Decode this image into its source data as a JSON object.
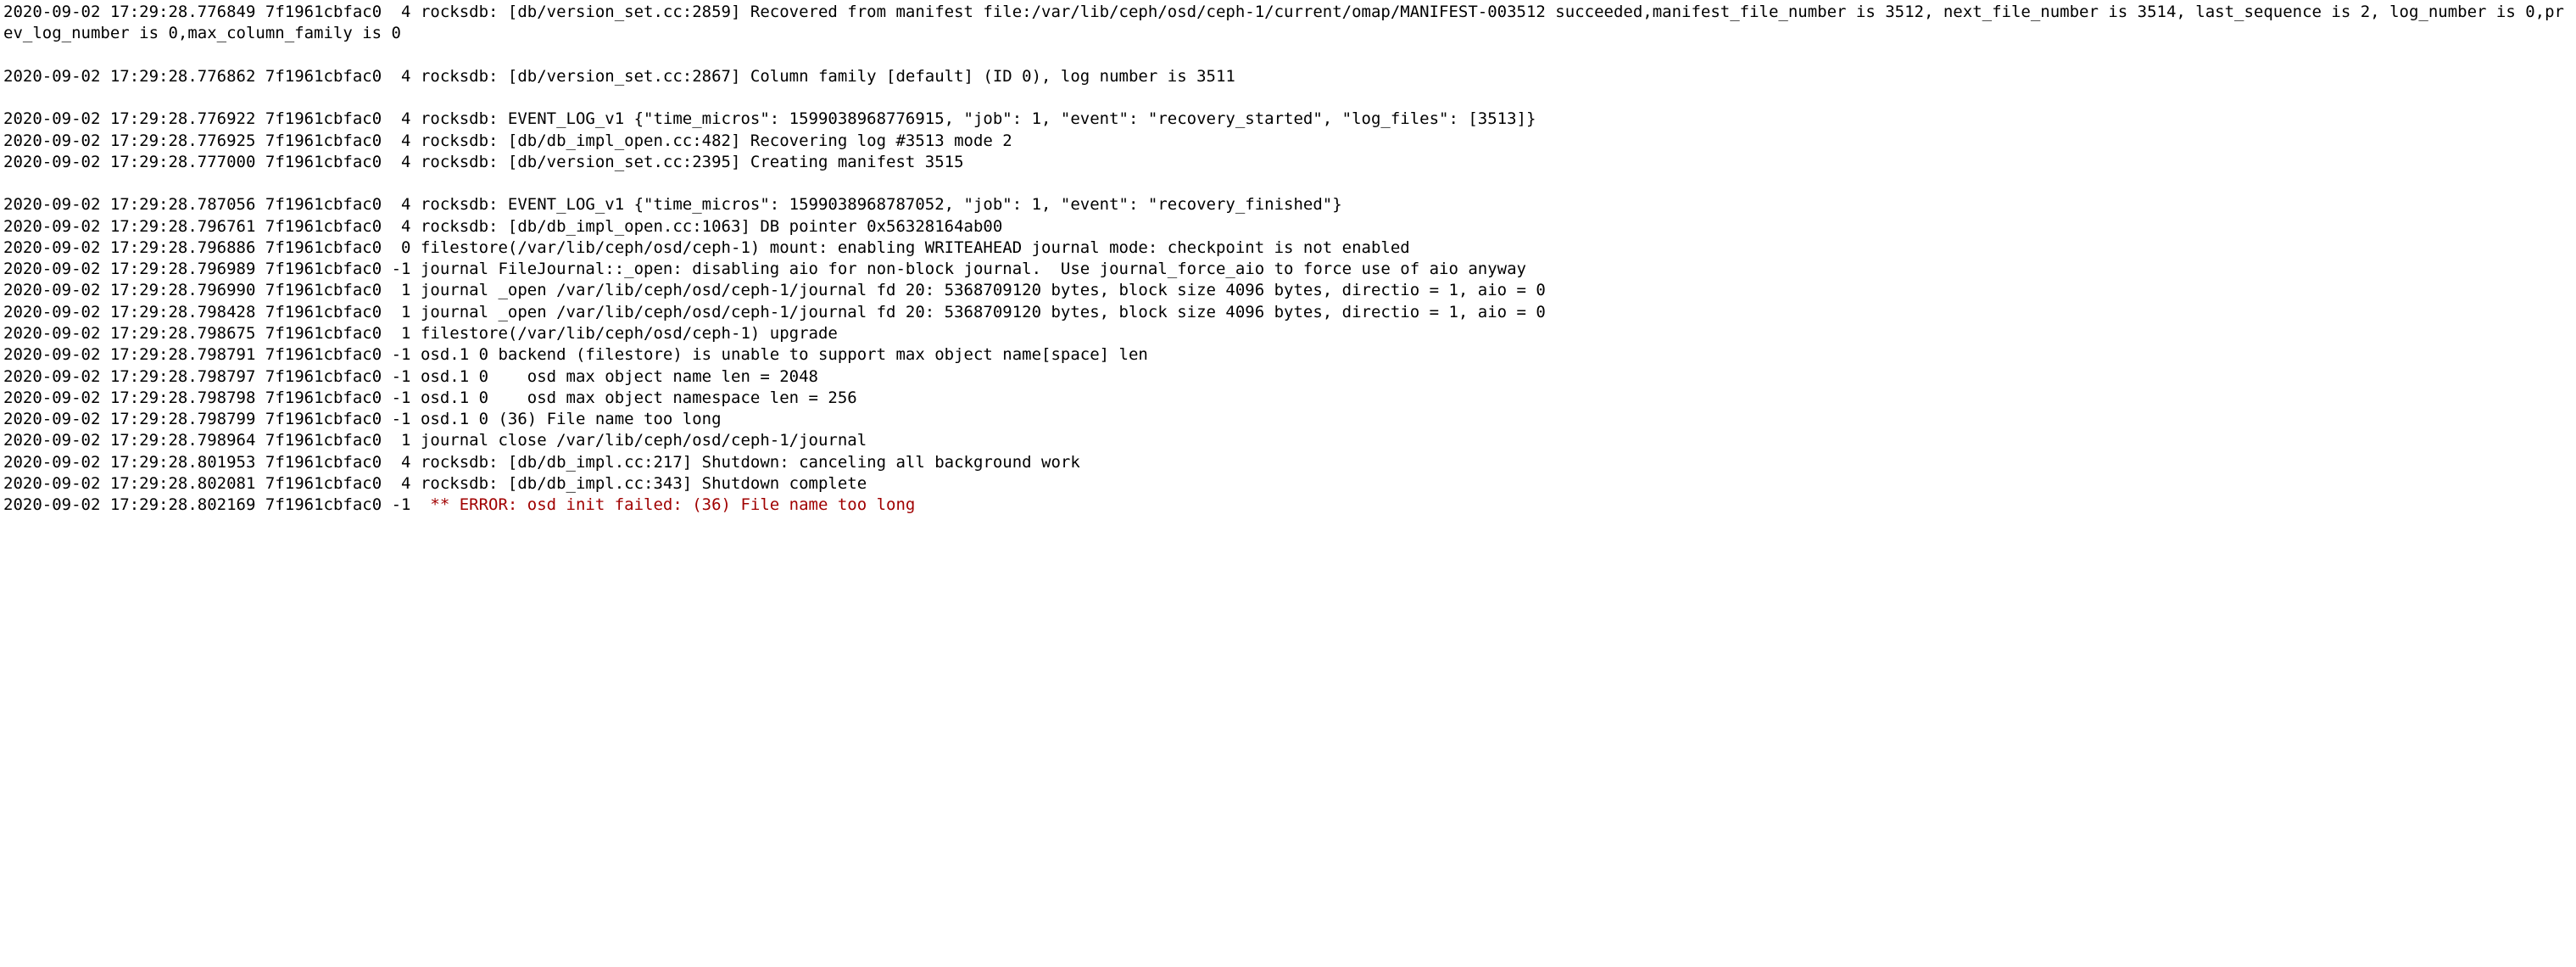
{
  "log_lines": [
    {
      "ts": "2020-09-02 17:29:28.776849",
      "thread": "7f1961cbfac0",
      "level": "4",
      "msg": "rocksdb: [db/version_set.cc:2859] Recovered from manifest file:/var/lib/ceph/osd/ceph-1/current/omap/MANIFEST-003512 succeeded,manifest_file_number is 3512, next_file_number is 3514, last_sequence is 2, log_number is 0,prev_log_number is 0,max_column_family is 0",
      "highlight": false,
      "blank_after": true
    },
    {
      "ts": "2020-09-02 17:29:28.776862",
      "thread": "7f1961cbfac0",
      "level": "4",
      "msg": "rocksdb: [db/version_set.cc:2867] Column family [default] (ID 0), log number is 3511",
      "highlight": false,
      "blank_after": true
    },
    {
      "ts": "2020-09-02 17:29:28.776922",
      "thread": "7f1961cbfac0",
      "level": "4",
      "msg": "rocksdb: EVENT_LOG_v1 {\"time_micros\": 1599038968776915, \"job\": 1, \"event\": \"recovery_started\", \"log_files\": [3513]}",
      "highlight": false,
      "blank_after": false
    },
    {
      "ts": "2020-09-02 17:29:28.776925",
      "thread": "7f1961cbfac0",
      "level": "4",
      "msg": "rocksdb: [db/db_impl_open.cc:482] Recovering log #3513 mode 2",
      "highlight": false,
      "blank_after": false
    },
    {
      "ts": "2020-09-02 17:29:28.777000",
      "thread": "7f1961cbfac0",
      "level": "4",
      "msg": "rocksdb: [db/version_set.cc:2395] Creating manifest 3515",
      "highlight": false,
      "blank_after": true
    },
    {
      "ts": "2020-09-02 17:29:28.787056",
      "thread": "7f1961cbfac0",
      "level": "4",
      "msg": "rocksdb: EVENT_LOG_v1 {\"time_micros\": 1599038968787052, \"job\": 1, \"event\": \"recovery_finished\"}",
      "highlight": false,
      "blank_after": false
    },
    {
      "ts": "2020-09-02 17:29:28.796761",
      "thread": "7f1961cbfac0",
      "level": "4",
      "msg": "rocksdb: [db/db_impl_open.cc:1063] DB pointer 0x56328164ab00",
      "highlight": false,
      "blank_after": false
    },
    {
      "ts": "2020-09-02 17:29:28.796886",
      "thread": "7f1961cbfac0",
      "level": "0",
      "msg": "filestore(/var/lib/ceph/osd/ceph-1) mount: enabling WRITEAHEAD journal mode: checkpoint is not enabled",
      "highlight": false,
      "blank_after": false
    },
    {
      "ts": "2020-09-02 17:29:28.796989",
      "thread": "7f1961cbfac0",
      "level": "-1",
      "msg": "journal FileJournal::_open: disabling aio for non-block journal.  Use journal_force_aio to force use of aio anyway",
      "highlight": false,
      "blank_after": false
    },
    {
      "ts": "2020-09-02 17:29:28.796990",
      "thread": "7f1961cbfac0",
      "level": "1",
      "msg": "journal _open /var/lib/ceph/osd/ceph-1/journal fd 20: 5368709120 bytes, block size 4096 bytes, directio = 1, aio = 0",
      "highlight": false,
      "blank_after": false
    },
    {
      "ts": "2020-09-02 17:29:28.798428",
      "thread": "7f1961cbfac0",
      "level": "1",
      "msg": "journal _open /var/lib/ceph/osd/ceph-1/journal fd 20: 5368709120 bytes, block size 4096 bytes, directio = 1, aio = 0",
      "highlight": false,
      "blank_after": false
    },
    {
      "ts": "2020-09-02 17:29:28.798675",
      "thread": "7f1961cbfac0",
      "level": "1",
      "msg": "filestore(/var/lib/ceph/osd/ceph-1) upgrade",
      "highlight": false,
      "blank_after": false
    },
    {
      "ts": "2020-09-02 17:29:28.798791",
      "thread": "7f1961cbfac0",
      "level": "-1",
      "msg": "osd.1 0 backend (filestore) is unable to support max object name[space] len",
      "highlight": false,
      "blank_after": false
    },
    {
      "ts": "2020-09-02 17:29:28.798797",
      "thread": "7f1961cbfac0",
      "level": "-1",
      "msg": "osd.1 0    osd max object name len = 2048",
      "highlight": false,
      "blank_after": false
    },
    {
      "ts": "2020-09-02 17:29:28.798798",
      "thread": "7f1961cbfac0",
      "level": "-1",
      "msg": "osd.1 0    osd max object namespace len = 256",
      "highlight": false,
      "blank_after": false
    },
    {
      "ts": "2020-09-02 17:29:28.798799",
      "thread": "7f1961cbfac0",
      "level": "-1",
      "msg": "osd.1 0 (36) File name too long",
      "highlight": false,
      "blank_after": false
    },
    {
      "ts": "2020-09-02 17:29:28.798964",
      "thread": "7f1961cbfac0",
      "level": "1",
      "msg": "journal close /var/lib/ceph/osd/ceph-1/journal",
      "highlight": false,
      "blank_after": false
    },
    {
      "ts": "2020-09-02 17:29:28.801953",
      "thread": "7f1961cbfac0",
      "level": "4",
      "msg": "rocksdb: [db/db_impl.cc:217] Shutdown: canceling all background work",
      "highlight": false,
      "blank_after": false
    },
    {
      "ts": "2020-09-02 17:29:28.802081",
      "thread": "7f1961cbfac0",
      "level": "4",
      "msg": "rocksdb: [db/db_impl.cc:343] Shutdown complete",
      "highlight": false,
      "blank_after": false
    },
    {
      "ts": "2020-09-02 17:29:28.802169",
      "thread": "7f1961cbfac0",
      "level": "-1",
      "msg": " ** ERROR: osd init failed: (36) File name too long",
      "highlight": true,
      "blank_after": false
    }
  ],
  "level_width": 2
}
